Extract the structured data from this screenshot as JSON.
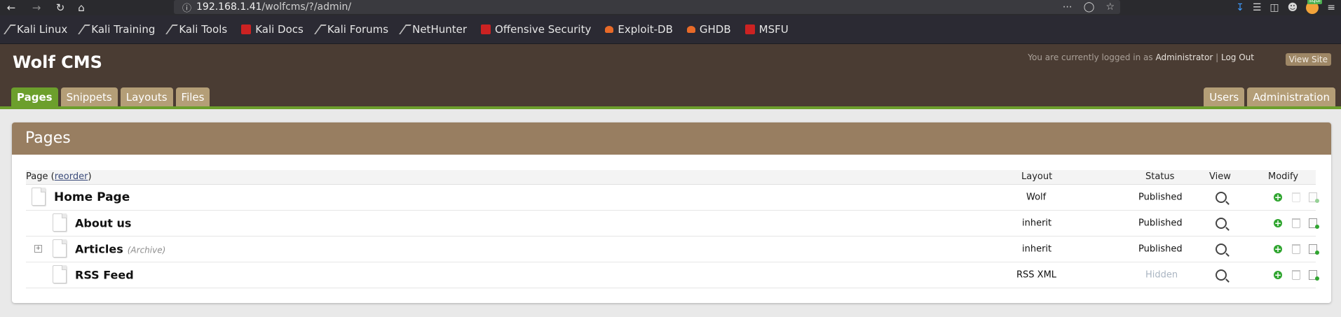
{
  "browser": {
    "url_host": "192.168.1.41",
    "url_path": "/wolfcms/?/admin/",
    "toolbar_icons": [
      "back-icon",
      "forward-icon",
      "reload-icon",
      "home-icon"
    ],
    "url_actions": [
      "more-icon",
      "pocket-icon",
      "star-icon"
    ],
    "tools": [
      "download-icon",
      "library-icon",
      "sidebar-icon",
      "account-icon",
      "extension-icon",
      "menu-icon"
    ],
    "avatar_badge": "squi",
    "bookmarks": [
      {
        "label": "Kali Linux",
        "icon": "kali-icon"
      },
      {
        "label": "Kali Training",
        "icon": "kali-icon"
      },
      {
        "label": "Kali Tools",
        "icon": "kali-icon"
      },
      {
        "label": "Kali Docs",
        "icon": "red-doc-icon"
      },
      {
        "label": "Kali Forums",
        "icon": "kali-icon"
      },
      {
        "label": "NetHunter",
        "icon": "kali-icon"
      },
      {
        "label": "Offensive Security",
        "icon": "offsec-icon"
      },
      {
        "label": "Exploit-DB",
        "icon": "exploitdb-icon"
      },
      {
        "label": "GHDB",
        "icon": "exploitdb-icon"
      },
      {
        "label": "MSFU",
        "icon": "offsec-icon"
      }
    ]
  },
  "cms": {
    "site_title": "Wolf CMS",
    "login_prefix": "You are currently logged in as",
    "username": "Administrator",
    "separator": "|",
    "logout": "Log Out",
    "view_site": "View Site",
    "tabs_left": [
      "Pages",
      "Snippets",
      "Layouts",
      "Files"
    ],
    "tabs_right": [
      "Users",
      "Administration"
    ],
    "active_tab": "Pages"
  },
  "pages_panel": {
    "heading": "Pages",
    "columns": {
      "page": "Page",
      "reorder": "reorder",
      "layout": "Layout",
      "status": "Status",
      "view": "View",
      "modify": "Modify"
    },
    "rows": [
      {
        "title": "Home Page",
        "note": "",
        "layout": "Wolf",
        "status": "Published",
        "level": 0
      },
      {
        "title": "About us",
        "note": "",
        "layout": "inherit",
        "status": "Published",
        "level": 1
      },
      {
        "title": "Articles",
        "note": "(Archive)",
        "layout": "inherit",
        "status": "Published",
        "level": 1
      },
      {
        "title": "RSS Feed",
        "note": "",
        "layout": "RSS XML",
        "status": "Hidden",
        "level": 1
      }
    ]
  },
  "colors": {
    "accent_green": "#6c9f2c",
    "header_brown": "#4a3c33",
    "panel_head": "#987e61",
    "tab_tan": "#b49e77"
  }
}
